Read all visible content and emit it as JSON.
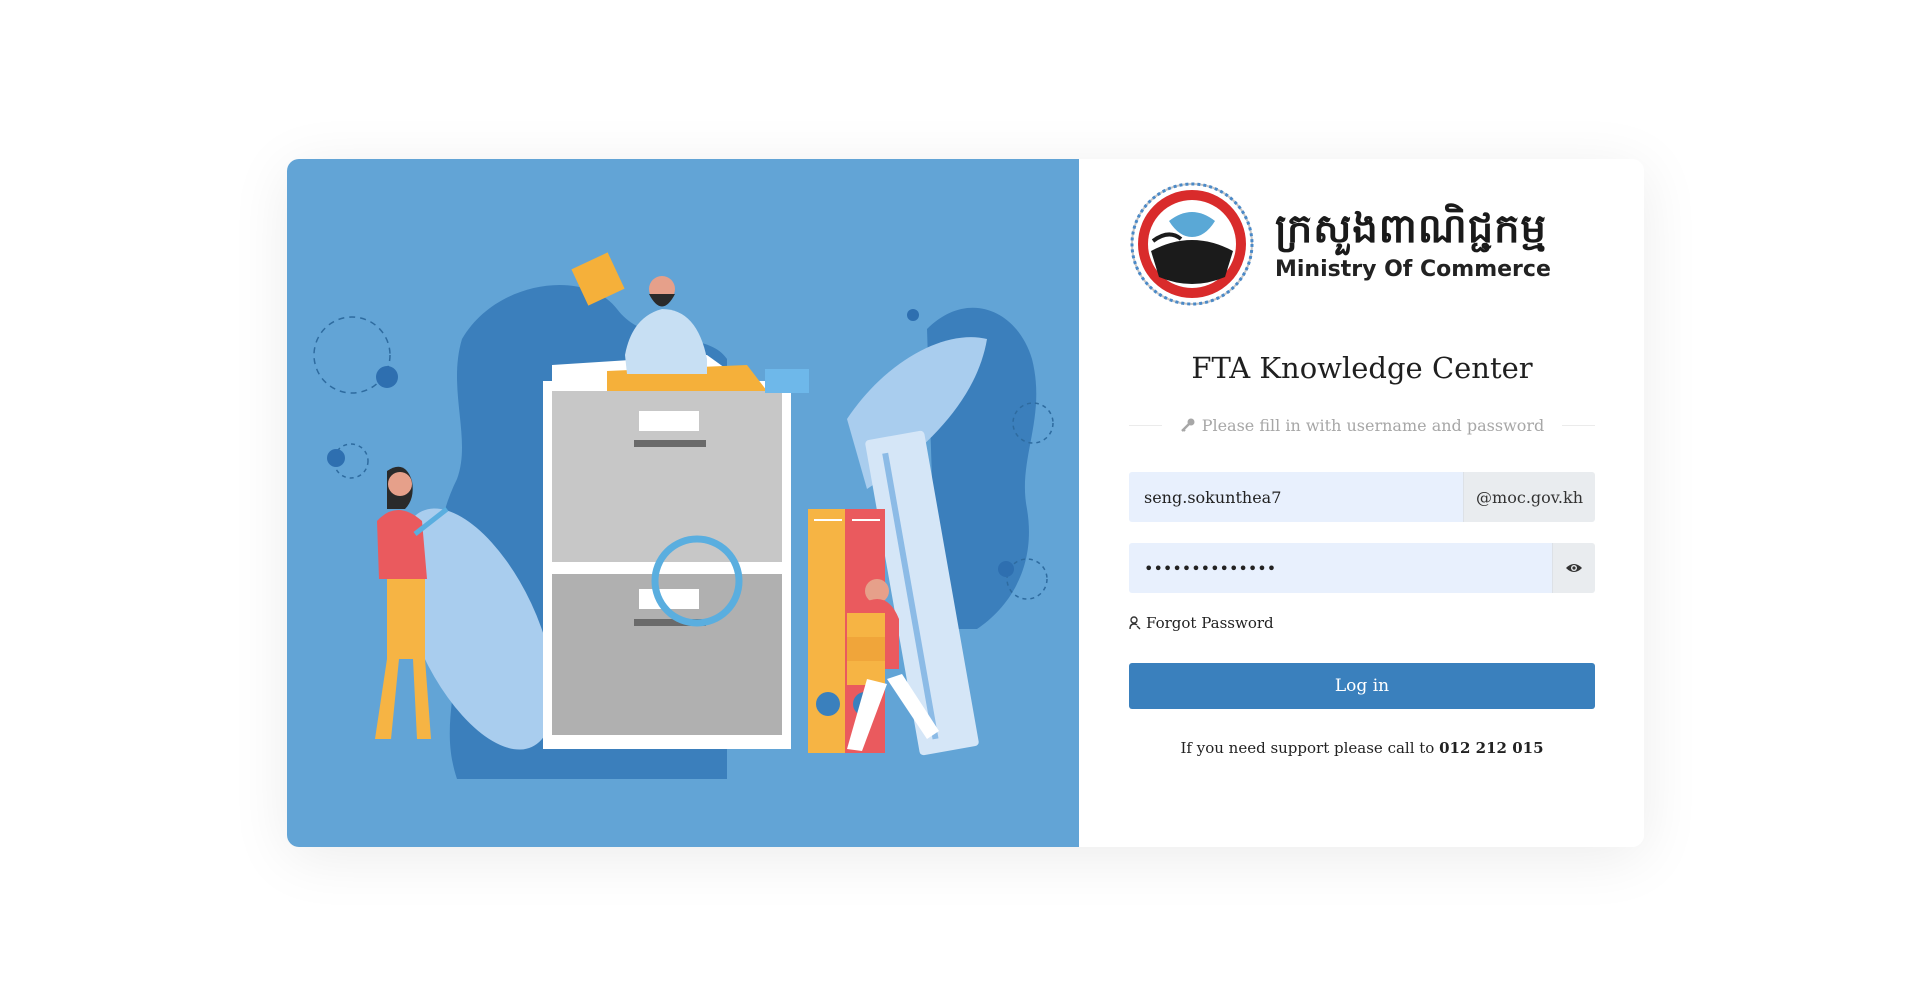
{
  "logo": {
    "khmer_text": "ក្រសួងពាណិជ្ជកម្ម",
    "english_text": "Ministry Of Commerce"
  },
  "page": {
    "title": "FTA Knowledge Center",
    "hint": "Please fill in with username and password",
    "hint_icon": "key-icon"
  },
  "form": {
    "username_value": "seng.sokunthea7",
    "domain_suffix": "@moc.gov.kh",
    "password_value": "••••••••••••••",
    "show_password_icon": "eye-icon",
    "forgot_label": "Forgot Password",
    "forgot_icon": "user-key-icon",
    "login_label": "Log in"
  },
  "support": {
    "text": "If you need support please call to",
    "phone": "012 212 015"
  },
  "colors": {
    "illustration_bg": "#62a4d6",
    "button": "#3a80bd",
    "input_bg": "#e8f0fd"
  }
}
